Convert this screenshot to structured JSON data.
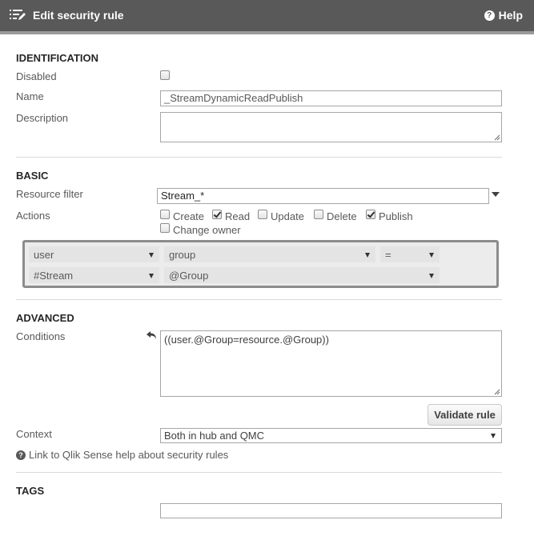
{
  "header": {
    "title": "Edit security rule",
    "help_label": "Help"
  },
  "identification": {
    "section_title": "IDENTIFICATION",
    "disabled_label": "Disabled",
    "disabled_checked": false,
    "name_label": "Name",
    "name_value": "_StreamDynamicReadPublish",
    "description_label": "Description",
    "description_value": ""
  },
  "basic": {
    "section_title": "BASIC",
    "resource_filter_label": "Resource filter",
    "resource_filter_value": "Stream_*",
    "actions_label": "Actions",
    "actions": [
      {
        "label": "Create",
        "checked": false
      },
      {
        "label": "Read",
        "checked": true
      },
      {
        "label": "Update",
        "checked": false
      },
      {
        "label": "Delete",
        "checked": false
      },
      {
        "label": "Publish",
        "checked": true
      },
      {
        "label": "Change owner",
        "checked": false
      }
    ],
    "builder": {
      "row1": {
        "subject": "user",
        "attribute": "group",
        "operator": "="
      },
      "row2": {
        "subject": "#Stream",
        "value": "@Group"
      }
    }
  },
  "advanced": {
    "section_title": "ADVANCED",
    "conditions_label": "Conditions",
    "conditions_value": "((user.@Group=resource.@Group))",
    "validate_label": "Validate rule",
    "context_label": "Context",
    "context_value": "Both in hub and QMC",
    "help_link": "Link to Qlik Sense help about security rules"
  },
  "tags": {
    "section_title": "TAGS",
    "value": ""
  }
}
